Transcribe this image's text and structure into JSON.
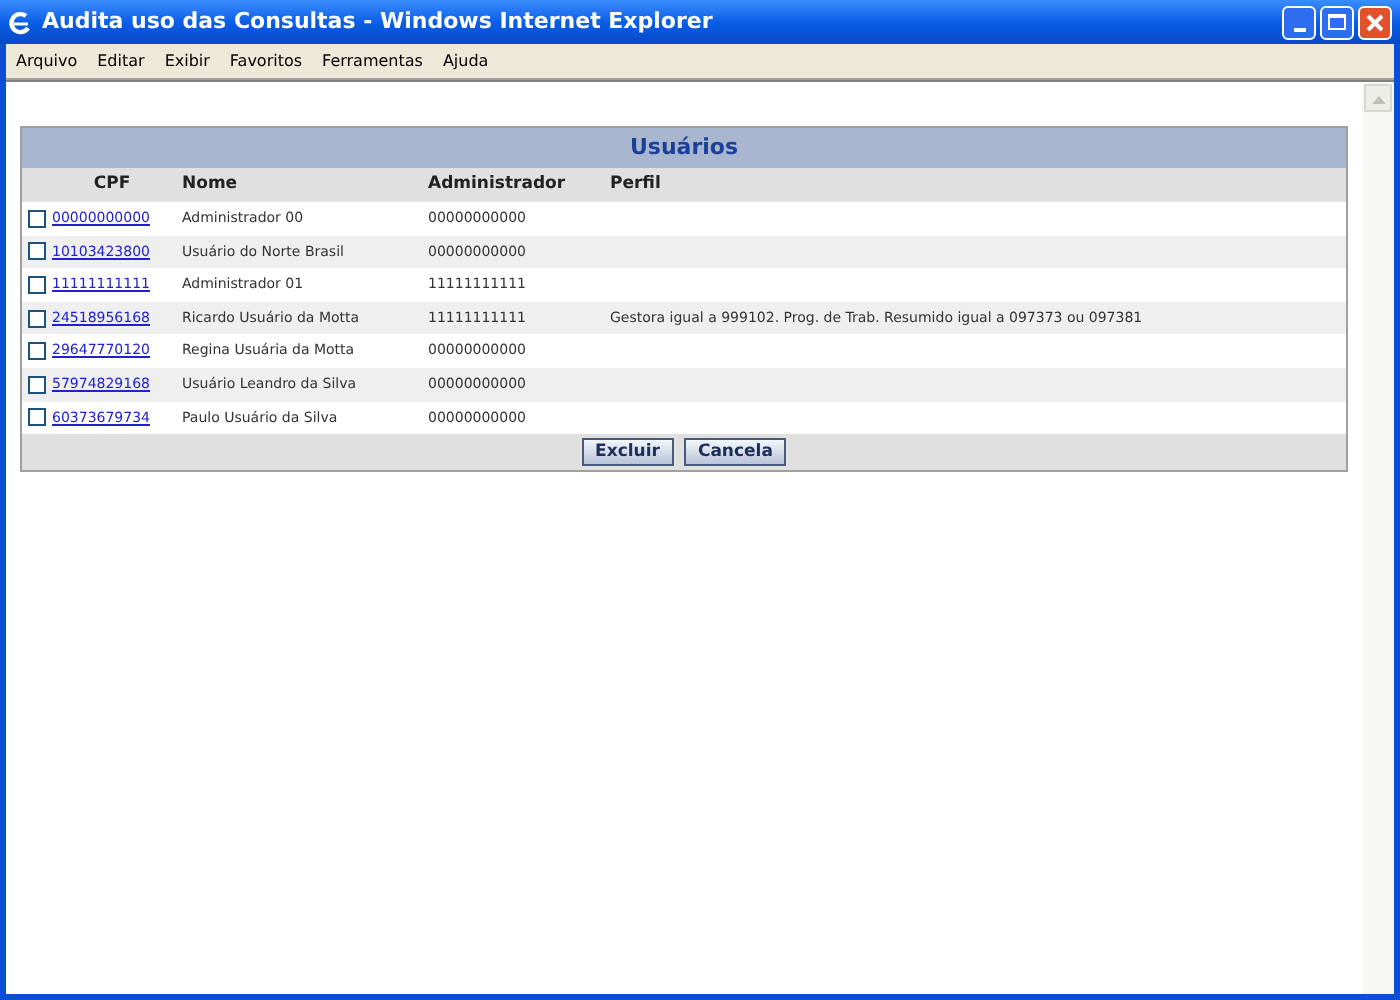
{
  "window": {
    "title": "Audita uso das Consultas - Windows Internet Explorer"
  },
  "menu": [
    "Arquivo",
    "Editar",
    "Exibir",
    "Favoritos",
    "Ferramentas",
    "Ajuda"
  ],
  "panel": {
    "title": "Usuários",
    "columns": [
      "CPF",
      "Nome",
      "Administrador",
      "Perfil"
    ],
    "rows": [
      {
        "checked": false,
        "cpf": "00000000000",
        "nome": "Administrador 00",
        "administrador": "00000000000"
      },
      {
        "checked": false,
        "cpf": "10103423800",
        "nome": "Usuário do Norte Brasil",
        "administrador": "00000000000"
      },
      {
        "checked": false,
        "cpf": "11111111111",
        "nome": "Administrador 01",
        "administrador": "11111111111"
      },
      {
        "checked": false,
        "cpf": "24518956168",
        "nome": "Ricardo Usuário da Motta",
        "administrador": "11111111111",
        "perfil": "Gestora igual a 999102. Prog. de Trab. Resumido igual a 097373 ou 097381"
      },
      {
        "checked": false,
        "cpf": "29647770120",
        "nome": "Regina Usuária da Motta",
        "administrador": "00000000000"
      },
      {
        "checked": false,
        "cpf": "57974829168",
        "nome": "Usuário Leandro da Silva",
        "administrador": "00000000000"
      },
      {
        "checked": false,
        "cpf": "60373679734",
        "nome": "Paulo Usuário da Silva",
        "administrador": "00000000000"
      }
    ],
    "buttons": [
      "Excluir",
      "Cancela"
    ]
  }
}
